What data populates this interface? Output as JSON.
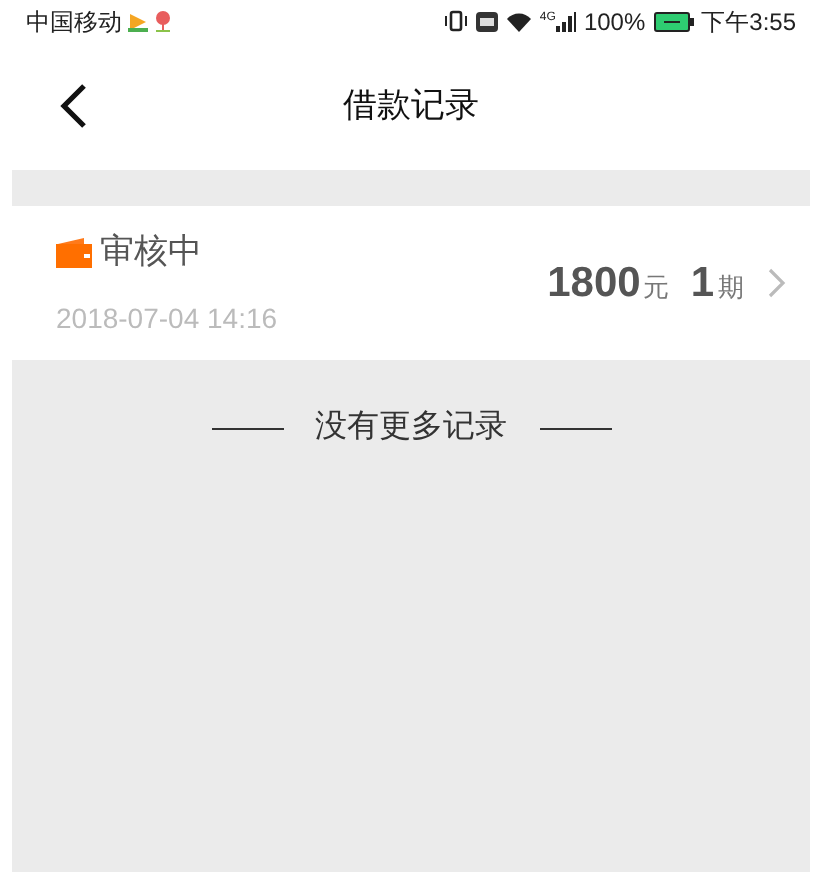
{
  "status_bar": {
    "carrier": "中国移动",
    "network": "4G",
    "battery": "100%",
    "time": "下午3:55"
  },
  "header": {
    "title": "借款记录"
  },
  "records": [
    {
      "status": "审核中",
      "date": "2018-07-04 14:16",
      "amount": "1800",
      "amount_unit": "元",
      "periods": "1",
      "periods_unit": "期"
    }
  ],
  "footer_note": "没有更多记录"
}
